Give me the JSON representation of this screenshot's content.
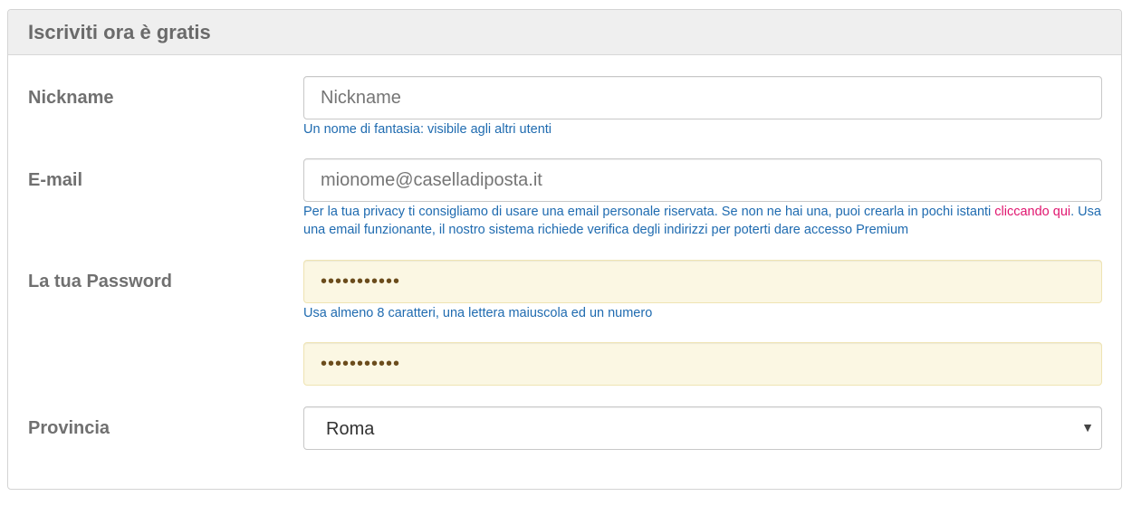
{
  "form": {
    "title": "Iscriviti ora è gratis",
    "nickname": {
      "label": "Nickname",
      "placeholder": "Nickname",
      "help": "Un nome di fantasia: visibile agli altri utenti"
    },
    "email": {
      "label": "E-mail",
      "placeholder": "mionome@caselladiposta.it",
      "help_before": "Per la tua privacy ti consigliamo di usare una email personale riservata. Se non ne hai una, puoi crearla in pochi istanti ",
      "help_link": "cliccando qui",
      "help_after": ". Usa una email funzionante, il nostro sistema richiede verifica degli indirizzi per poterti dare accesso Premium"
    },
    "password": {
      "label": "La tua Password",
      "value": "•••••••••••",
      "help": "Usa almeno 8 caratteri, una lettera maiuscola ed un numero",
      "confirm_value": "•••••••••••"
    },
    "provincia": {
      "label": "Provincia",
      "selected": "Roma",
      "caret": "▼"
    }
  },
  "colors": {
    "help_text": "#1f6bb0",
    "link": "#e0166f",
    "autofill_bg": "#fbf7e3",
    "heading_bg": "#efefef",
    "label": "#707070"
  }
}
